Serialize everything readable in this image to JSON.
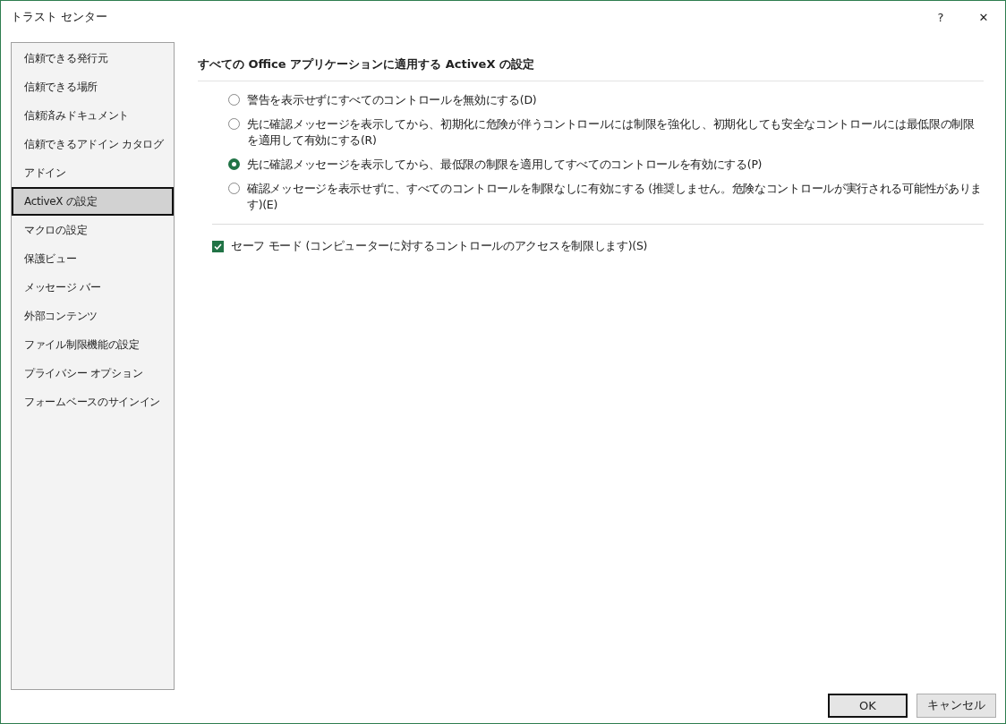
{
  "window": {
    "title": "トラスト センター",
    "help": "?",
    "close": "✕"
  },
  "sidebar": {
    "items": [
      {
        "label": "信頼できる発行元",
        "selected": false
      },
      {
        "label": "信頼できる場所",
        "selected": false
      },
      {
        "label": "信頼済みドキュメント",
        "selected": false
      },
      {
        "label": "信頼できるアドイン カタログ",
        "selected": false
      },
      {
        "label": "アドイン",
        "selected": false
      },
      {
        "label": "ActiveX の設定",
        "selected": true
      },
      {
        "label": "マクロの設定",
        "selected": false
      },
      {
        "label": "保護ビュー",
        "selected": false
      },
      {
        "label": "メッセージ バー",
        "selected": false
      },
      {
        "label": "外部コンテンツ",
        "selected": false
      },
      {
        "label": "ファイル制限機能の設定",
        "selected": false
      },
      {
        "label": "プライバシー オプション",
        "selected": false
      },
      {
        "label": "フォームベースのサインイン",
        "selected": false
      }
    ]
  },
  "section": {
    "heading": "すべての Office アプリケーションに適用する ActiveX の設定",
    "options": [
      {
        "label": "警告を表示せずにすべてのコントロールを無効にする(D)",
        "selected": false
      },
      {
        "label": "先に確認メッセージを表示してから、初期化に危険が伴うコントロールには制限を強化し、初期化しても安全なコントロールには最低限の制限を適用して有効にする(R)",
        "selected": false
      },
      {
        "label": "先に確認メッセージを表示してから、最低限の制限を適用してすべてのコントロールを有効にする(P)",
        "selected": true
      },
      {
        "label": "確認メッセージを表示せずに、すべてのコントロールを制限なしに有効にする (推奨しません。危険なコントロールが実行される可能性があります)(E)",
        "selected": false
      }
    ],
    "safe_mode": {
      "label": "セーフ モード (コンピューターに対するコントロールのアクセスを制限します)(S)",
      "checked": true
    }
  },
  "buttons": [
    {
      "label": "OK",
      "default": true
    },
    {
      "label": "キャンセル",
      "default": false
    }
  ]
}
